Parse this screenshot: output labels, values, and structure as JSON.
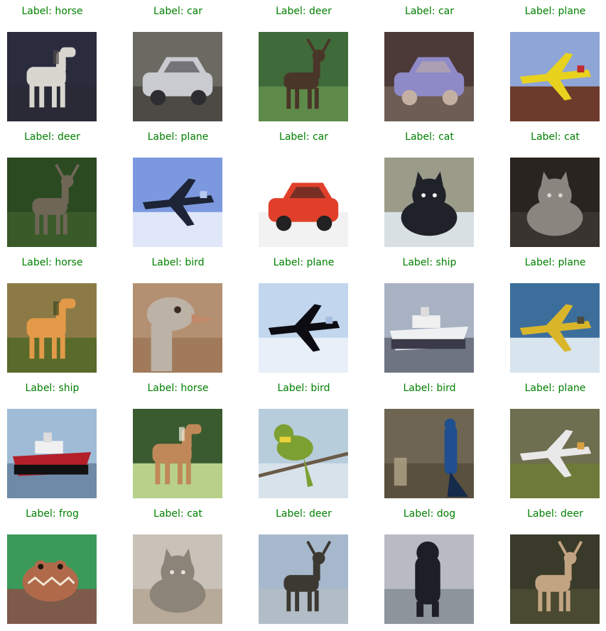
{
  "label_color": "#008000",
  "cells": [
    {
      "text": "Label: horse",
      "subject": "white-horse",
      "sky": "#2a2c3e",
      "ground": "#2a2a36",
      "main": "#d8d6cf",
      "accent": "#4e4a48"
    },
    {
      "text": "Label: car",
      "subject": "silver-car",
      "sky": "#6a6a62",
      "ground": "#4b4a44",
      "main": "#c9cbd0",
      "accent": "#2e2e30"
    },
    {
      "text": "Label: deer",
      "subject": "deer",
      "sky": "#3f6a3a",
      "ground": "#5e8a4a",
      "main": "#4a3628",
      "accent": "#7fa5b0"
    },
    {
      "text": "Label: car",
      "subject": "purple-van",
      "sky": "#4b3a38",
      "ground": "#6e5d55",
      "main": "#8e8ac8",
      "accent": "#c3b0a2"
    },
    {
      "text": "Label: plane",
      "subject": "yellow-plane",
      "sky": "#8fa5d6",
      "ground": "#6c3b2c",
      "main": "#e8d21e",
      "accent": "#c02a2a"
    },
    {
      "text": "Label: deer",
      "subject": "deer-face",
      "sky": "#2b4a22",
      "ground": "#3a5a2a",
      "main": "#6f6656",
      "accent": "#1c3214"
    },
    {
      "text": "Label: plane",
      "subject": "sky-plane",
      "sky": "#7c99e0",
      "ground": "#dfe7f8",
      "main": "#1d2436",
      "accent": "#b9c8ef"
    },
    {
      "text": "Label: car",
      "subject": "red-car",
      "sky": "#ffffff",
      "ground": "#f2f2f2",
      "main": "#e0402a",
      "accent": "#222222"
    },
    {
      "text": "Label: cat",
      "subject": "black-cat",
      "sky": "#9b9b8a",
      "ground": "#d8e0e4",
      "main": "#1f2228",
      "accent": "#eef3f4"
    },
    {
      "text": "Label: cat",
      "subject": "grey-cat",
      "sky": "#2a2421",
      "ground": "#3a3430",
      "main": "#8b8580",
      "accent": "#d9d4cf"
    },
    {
      "text": "Label: horse",
      "subject": "orange-horse",
      "sky": "#8c7a46",
      "ground": "#5a6a2a",
      "main": "#e29a48",
      "accent": "#3a4a20"
    },
    {
      "text": "Label: bird",
      "subject": "ostrich",
      "sky": "#b49072",
      "ground": "#a07a5a",
      "main": "#bdb2a6",
      "accent": "#6a5040"
    },
    {
      "text": "Label: plane",
      "subject": "dark-jet",
      "sky": "#c2d6ee",
      "ground": "#e8eff8",
      "main": "#0c0c12",
      "accent": "#a6bede"
    },
    {
      "text": "Label: ship",
      "subject": "white-ship",
      "sky": "#a8b2c2",
      "ground": "#6e7482",
      "main": "#eef0f2",
      "accent": "#3a3a48"
    },
    {
      "text": "Label: plane",
      "subject": "yellow-seaplane",
      "sky": "#3c6e9c",
      "ground": "#d8e4ee",
      "main": "#d9b52a",
      "accent": "#4a4a3a"
    },
    {
      "text": "Label: ship",
      "subject": "red-ship",
      "sky": "#9fbcd6",
      "ground": "#6e8aa6",
      "main": "#b3202a",
      "accent": "#111111"
    },
    {
      "text": "Label: horse",
      "subject": "brown-horse",
      "sky": "#3a5a30",
      "ground": "#b8d08a",
      "main": "#c08858",
      "accent": "#f0f0e0"
    },
    {
      "text": "Label: bird",
      "subject": "bee-eater",
      "sky": "#b8cddc",
      "ground": "#d8e2ea",
      "main": "#7da032",
      "accent": "#e9d23a"
    },
    {
      "text": "Label: bird",
      "subject": "peacock",
      "sky": "#6e6652",
      "ground": "#5a503e",
      "main": "#1f4f8e",
      "accent": "#b0a48a"
    },
    {
      "text": "Label: plane",
      "subject": "white-jet",
      "sky": "#6e6e50",
      "ground": "#6c7a3a",
      "main": "#e8e8e8",
      "accent": "#d8a040"
    },
    {
      "text": "Label: frog",
      "subject": "frog",
      "sky": "#3a9a5a",
      "ground": "#7e5a4a",
      "main": "#b06a4a",
      "accent": "#f2e6d6"
    },
    {
      "text": "Label: cat",
      "subject": "tabby-cat",
      "sky": "#c8c2b8",
      "ground": "#b8aa98",
      "main": "#8c8478",
      "accent": "#e4e2da"
    },
    {
      "text": "Label: deer",
      "subject": "antlered-deer",
      "sky": "#a6b8cc",
      "ground": "#b2bcc6",
      "main": "#3c3832",
      "accent": "#ccd6de"
    },
    {
      "text": "Label: dog",
      "subject": "black-dog",
      "sky": "#b8bcc2",
      "ground": "#8e949c",
      "main": "#1e1e26",
      "accent": "#c8ccd2"
    },
    {
      "text": "Label: deer",
      "subject": "elk",
      "sky": "#3a3a2a",
      "ground": "#4a4a32",
      "main": "#c2a482",
      "accent": "#2a2a1c"
    }
  ]
}
